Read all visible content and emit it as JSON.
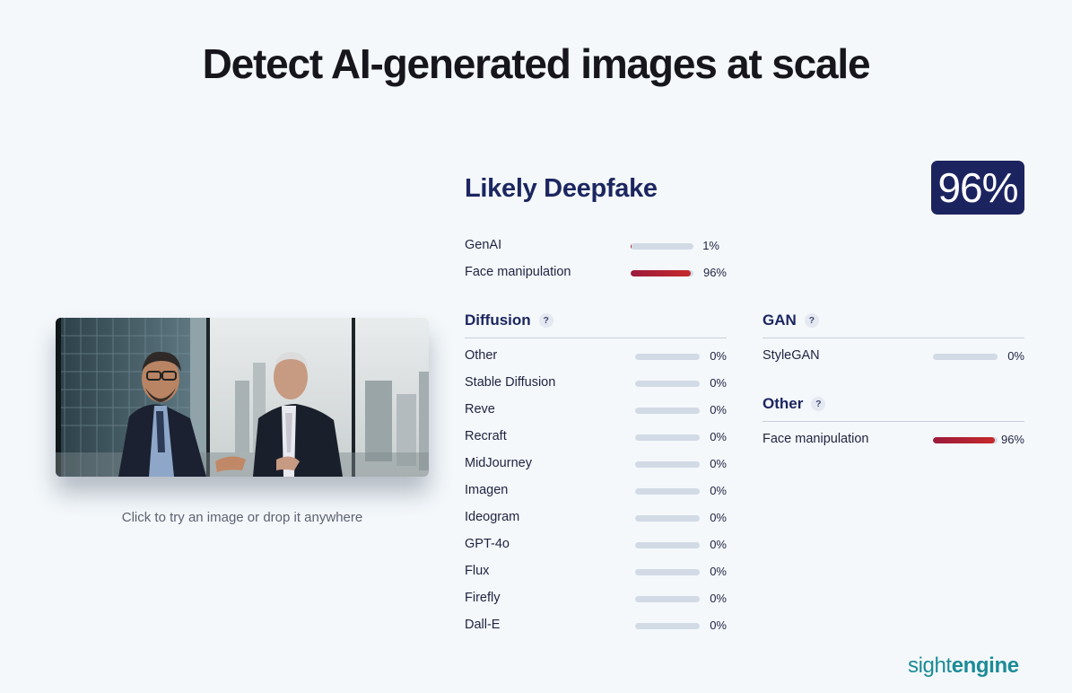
{
  "headline": "Detect AI-generated images at scale",
  "photo": {
    "caption": "Click to try an image or drop it anywhere"
  },
  "result": {
    "verdict": "Likely Deepfake",
    "score": "96%"
  },
  "summary": [
    {
      "label": "GenAI",
      "value": 0.01,
      "pct": "1%"
    },
    {
      "label": "Face manipulation",
      "value": 0.96,
      "pct": "96%"
    }
  ],
  "diffusion": {
    "title": "Diffusion",
    "help": "?",
    "rows": [
      {
        "label": "Other",
        "value": 0,
        "pct": "0%"
      },
      {
        "label": "Stable Diffusion",
        "value": 0,
        "pct": "0%"
      },
      {
        "label": "Reve",
        "value": 0,
        "pct": "0%"
      },
      {
        "label": "Recraft",
        "value": 0,
        "pct": "0%"
      },
      {
        "label": "MidJourney",
        "value": 0,
        "pct": "0%"
      },
      {
        "label": "Imagen",
        "value": 0,
        "pct": "0%"
      },
      {
        "label": "Ideogram",
        "value": 0,
        "pct": "0%"
      },
      {
        "label": "GPT-4o",
        "value": 0,
        "pct": "0%"
      },
      {
        "label": "Flux",
        "value": 0,
        "pct": "0%"
      },
      {
        "label": "Firefly",
        "value": 0,
        "pct": "0%"
      },
      {
        "label": "Dall-E",
        "value": 0,
        "pct": "0%"
      }
    ]
  },
  "gan": {
    "title": "GAN",
    "help": "?",
    "rows": [
      {
        "label": "StyleGAN",
        "value": 0,
        "pct": "0%"
      }
    ]
  },
  "other": {
    "title": "Other",
    "help": "?",
    "rows": [
      {
        "label": "Face manipulation",
        "value": 0.96,
        "pct": "96%"
      }
    ]
  },
  "brand": {
    "part1": "sight",
    "part2": "engine"
  },
  "colors": {
    "navy": "#1c2460",
    "bar_fill_start": "#9c1a3c",
    "bar_fill_end": "#c52a2a",
    "bar_track": "#d2dae5",
    "brand_teal": "#1c8b96"
  }
}
